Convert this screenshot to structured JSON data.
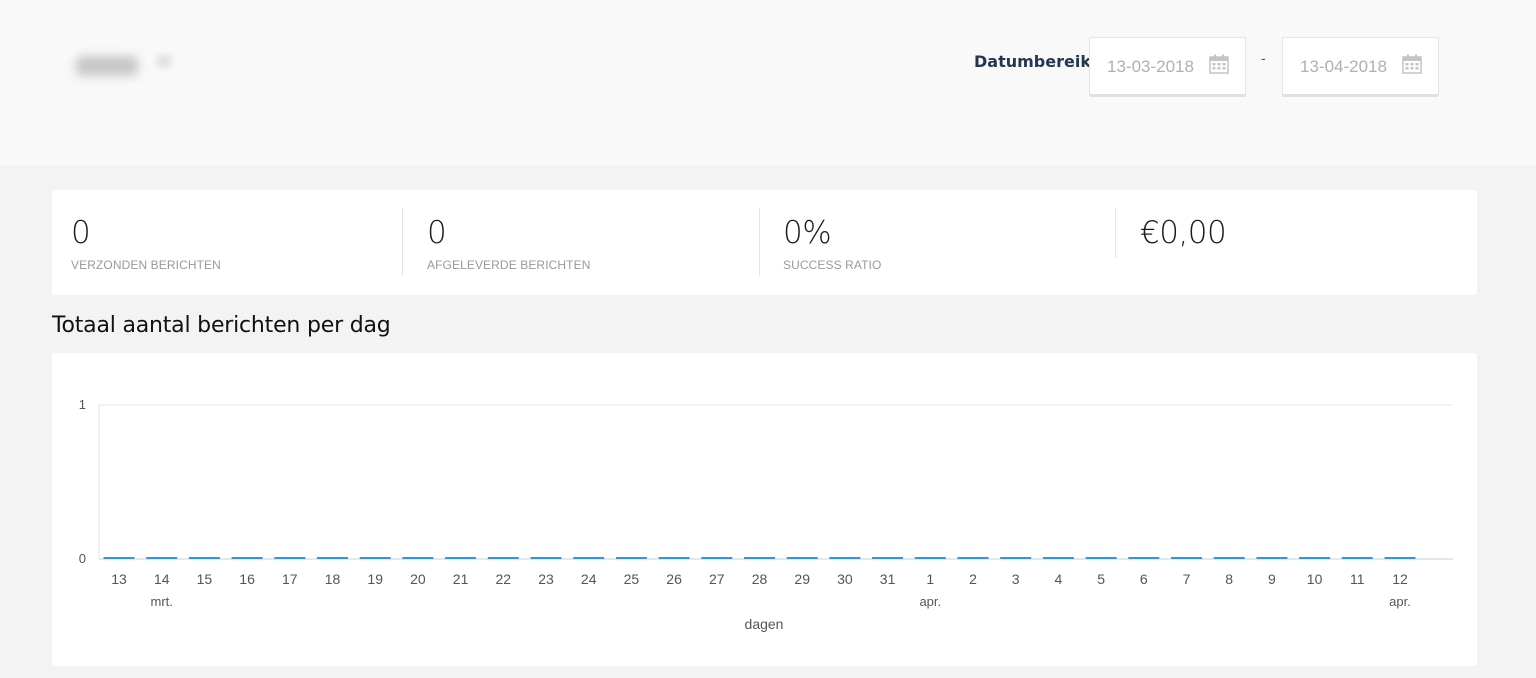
{
  "header": {
    "date_label": "Datumbereik",
    "date_from": "13-03-2018",
    "date_to": "13-04-2018",
    "date_separator": "-",
    "calendar_icon": "calendar-icon"
  },
  "stats": [
    {
      "value": "0",
      "label": "VERZONDEN BERICHTEN"
    },
    {
      "value": "0",
      "label": "AFGELEVERDE BERICHTEN"
    },
    {
      "value": "0%",
      "label": "SUCCESS RATIO"
    },
    {
      "value": "€0,00",
      "label": ""
    }
  ],
  "chart_title": "Totaal aantal berichten per dag",
  "chart_data": {
    "type": "bar",
    "categories": [
      "13",
      "14",
      "15",
      "16",
      "17",
      "18",
      "19",
      "20",
      "21",
      "22",
      "23",
      "24",
      "25",
      "26",
      "27",
      "28",
      "29",
      "30",
      "31",
      "1",
      "2",
      "3",
      "4",
      "5",
      "6",
      "7",
      "8",
      "9",
      "10",
      "11",
      "12"
    ],
    "month_labels": [
      {
        "category": "14",
        "label": "mrt."
      },
      {
        "category": "1",
        "label": "apr."
      },
      {
        "category": "12",
        "label": "apr."
      }
    ],
    "values": [
      0,
      0,
      0,
      0,
      0,
      0,
      0,
      0,
      0,
      0,
      0,
      0,
      0,
      0,
      0,
      0,
      0,
      0,
      0,
      0,
      0,
      0,
      0,
      0,
      0,
      0,
      0,
      0,
      0,
      0,
      0
    ],
    "xlabel": "dagen",
    "ylabel": "",
    "ylim": [
      0,
      1
    ],
    "yticks": [
      0,
      1
    ],
    "grid": true,
    "bar_color": "#2d9ad6"
  }
}
